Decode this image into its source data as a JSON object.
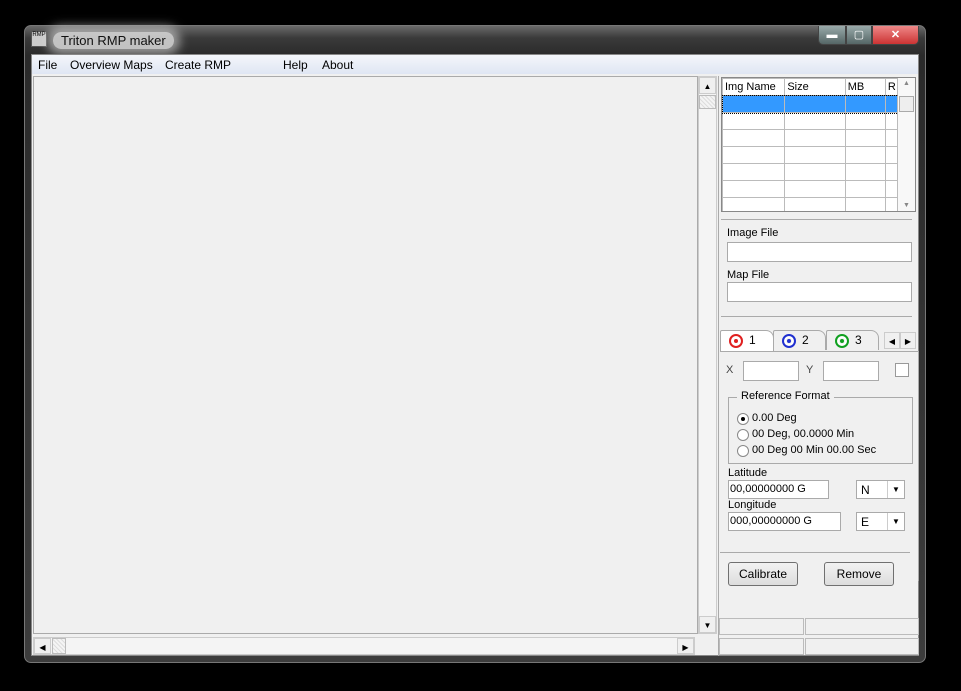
{
  "window": {
    "title": "Triton RMP maker",
    "icon_text": "RMP"
  },
  "menu": [
    "File",
    "Overview Maps",
    "Create RMP",
    "Help",
    "About"
  ],
  "table": {
    "columns": [
      "Img Name",
      "Size",
      "MB",
      "R"
    ],
    "row_count": 7
  },
  "image_file": {
    "label": "Image File",
    "value": ""
  },
  "map_file": {
    "label": "Map File",
    "value": ""
  },
  "tabs": [
    {
      "label": "1",
      "color": "#e02020"
    },
    {
      "label": "2",
      "color": "#2030d0"
    },
    {
      "label": "3",
      "color": "#10a020"
    }
  ],
  "xy": {
    "x_label": "X",
    "y_label": "Y",
    "x_value": "",
    "y_value": ""
  },
  "reference_format": {
    "title": "Reference Format",
    "options": [
      "0.00 Deg",
      "00 Deg, 00.0000 Min",
      "00 Deg 00 Min 00.00 Sec"
    ],
    "selected": 0
  },
  "latitude": {
    "label": "Latitude",
    "value": "00,00000000 G",
    "hemisphere": "N"
  },
  "longitude": {
    "label": "Longitude",
    "value": "000,00000000 G",
    "hemisphere": "E"
  },
  "buttons": {
    "calibrate": "Calibrate",
    "remove": "Remove"
  }
}
